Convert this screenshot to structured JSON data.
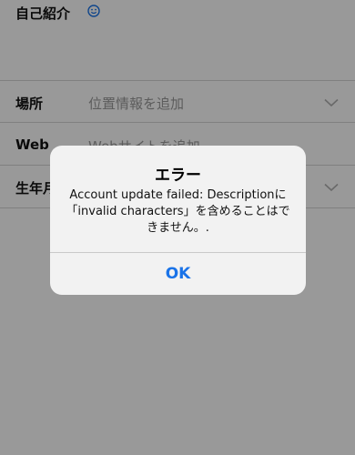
{
  "profile": {
    "bio_label": "自己紹介",
    "location_label": "場所",
    "location_placeholder": "位置情報を追加",
    "web_label": "Web",
    "web_placeholder": "Webサイトを追加",
    "birthday_label": "生年月日"
  },
  "alert": {
    "title": "エラー",
    "message": "Account update failed: Descriptionに「invalid characters」を含めることはできません。.",
    "ok_label": "OK"
  },
  "colors": {
    "accent": "#1a73e8",
    "placeholder": "#9a9a9a",
    "overlay": "rgba(0,0,0,0.40)"
  },
  "icons": {
    "bio_emoji": "smiley-icon",
    "dropdown": "chevron-down-icon"
  }
}
